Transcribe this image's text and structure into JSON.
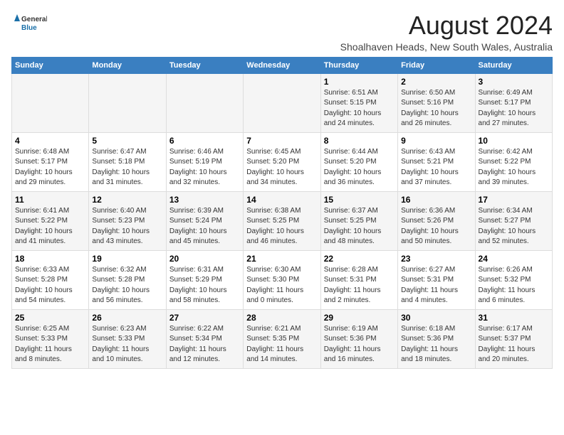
{
  "logo": {
    "line1": "General",
    "line2": "Blue"
  },
  "title": "August 2024",
  "subtitle": "Shoalhaven Heads, New South Wales, Australia",
  "days_of_week": [
    "Sunday",
    "Monday",
    "Tuesday",
    "Wednesday",
    "Thursday",
    "Friday",
    "Saturday"
  ],
  "weeks": [
    {
      "days": [
        {
          "num": "",
          "info": ""
        },
        {
          "num": "",
          "info": ""
        },
        {
          "num": "",
          "info": ""
        },
        {
          "num": "",
          "info": ""
        },
        {
          "num": "1",
          "info": "Sunrise: 6:51 AM\nSunset: 5:15 PM\nDaylight: 10 hours\nand 24 minutes."
        },
        {
          "num": "2",
          "info": "Sunrise: 6:50 AM\nSunset: 5:16 PM\nDaylight: 10 hours\nand 26 minutes."
        },
        {
          "num": "3",
          "info": "Sunrise: 6:49 AM\nSunset: 5:17 PM\nDaylight: 10 hours\nand 27 minutes."
        }
      ]
    },
    {
      "days": [
        {
          "num": "4",
          "info": "Sunrise: 6:48 AM\nSunset: 5:17 PM\nDaylight: 10 hours\nand 29 minutes."
        },
        {
          "num": "5",
          "info": "Sunrise: 6:47 AM\nSunset: 5:18 PM\nDaylight: 10 hours\nand 31 minutes."
        },
        {
          "num": "6",
          "info": "Sunrise: 6:46 AM\nSunset: 5:19 PM\nDaylight: 10 hours\nand 32 minutes."
        },
        {
          "num": "7",
          "info": "Sunrise: 6:45 AM\nSunset: 5:20 PM\nDaylight: 10 hours\nand 34 minutes."
        },
        {
          "num": "8",
          "info": "Sunrise: 6:44 AM\nSunset: 5:20 PM\nDaylight: 10 hours\nand 36 minutes."
        },
        {
          "num": "9",
          "info": "Sunrise: 6:43 AM\nSunset: 5:21 PM\nDaylight: 10 hours\nand 37 minutes."
        },
        {
          "num": "10",
          "info": "Sunrise: 6:42 AM\nSunset: 5:22 PM\nDaylight: 10 hours\nand 39 minutes."
        }
      ]
    },
    {
      "days": [
        {
          "num": "11",
          "info": "Sunrise: 6:41 AM\nSunset: 5:22 PM\nDaylight: 10 hours\nand 41 minutes."
        },
        {
          "num": "12",
          "info": "Sunrise: 6:40 AM\nSunset: 5:23 PM\nDaylight: 10 hours\nand 43 minutes."
        },
        {
          "num": "13",
          "info": "Sunrise: 6:39 AM\nSunset: 5:24 PM\nDaylight: 10 hours\nand 45 minutes."
        },
        {
          "num": "14",
          "info": "Sunrise: 6:38 AM\nSunset: 5:25 PM\nDaylight: 10 hours\nand 46 minutes."
        },
        {
          "num": "15",
          "info": "Sunrise: 6:37 AM\nSunset: 5:25 PM\nDaylight: 10 hours\nand 48 minutes."
        },
        {
          "num": "16",
          "info": "Sunrise: 6:36 AM\nSunset: 5:26 PM\nDaylight: 10 hours\nand 50 minutes."
        },
        {
          "num": "17",
          "info": "Sunrise: 6:34 AM\nSunset: 5:27 PM\nDaylight: 10 hours\nand 52 minutes."
        }
      ]
    },
    {
      "days": [
        {
          "num": "18",
          "info": "Sunrise: 6:33 AM\nSunset: 5:28 PM\nDaylight: 10 hours\nand 54 minutes."
        },
        {
          "num": "19",
          "info": "Sunrise: 6:32 AM\nSunset: 5:28 PM\nDaylight: 10 hours\nand 56 minutes."
        },
        {
          "num": "20",
          "info": "Sunrise: 6:31 AM\nSunset: 5:29 PM\nDaylight: 10 hours\nand 58 minutes."
        },
        {
          "num": "21",
          "info": "Sunrise: 6:30 AM\nSunset: 5:30 PM\nDaylight: 11 hours\nand 0 minutes."
        },
        {
          "num": "22",
          "info": "Sunrise: 6:28 AM\nSunset: 5:31 PM\nDaylight: 11 hours\nand 2 minutes."
        },
        {
          "num": "23",
          "info": "Sunrise: 6:27 AM\nSunset: 5:31 PM\nDaylight: 11 hours\nand 4 minutes."
        },
        {
          "num": "24",
          "info": "Sunrise: 6:26 AM\nSunset: 5:32 PM\nDaylight: 11 hours\nand 6 minutes."
        }
      ]
    },
    {
      "days": [
        {
          "num": "25",
          "info": "Sunrise: 6:25 AM\nSunset: 5:33 PM\nDaylight: 11 hours\nand 8 minutes."
        },
        {
          "num": "26",
          "info": "Sunrise: 6:23 AM\nSunset: 5:33 PM\nDaylight: 11 hours\nand 10 minutes."
        },
        {
          "num": "27",
          "info": "Sunrise: 6:22 AM\nSunset: 5:34 PM\nDaylight: 11 hours\nand 12 minutes."
        },
        {
          "num": "28",
          "info": "Sunrise: 6:21 AM\nSunset: 5:35 PM\nDaylight: 11 hours\nand 14 minutes."
        },
        {
          "num": "29",
          "info": "Sunrise: 6:19 AM\nSunset: 5:36 PM\nDaylight: 11 hours\nand 16 minutes."
        },
        {
          "num": "30",
          "info": "Sunrise: 6:18 AM\nSunset: 5:36 PM\nDaylight: 11 hours\nand 18 minutes."
        },
        {
          "num": "31",
          "info": "Sunrise: 6:17 AM\nSunset: 5:37 PM\nDaylight: 11 hours\nand 20 minutes."
        }
      ]
    }
  ]
}
